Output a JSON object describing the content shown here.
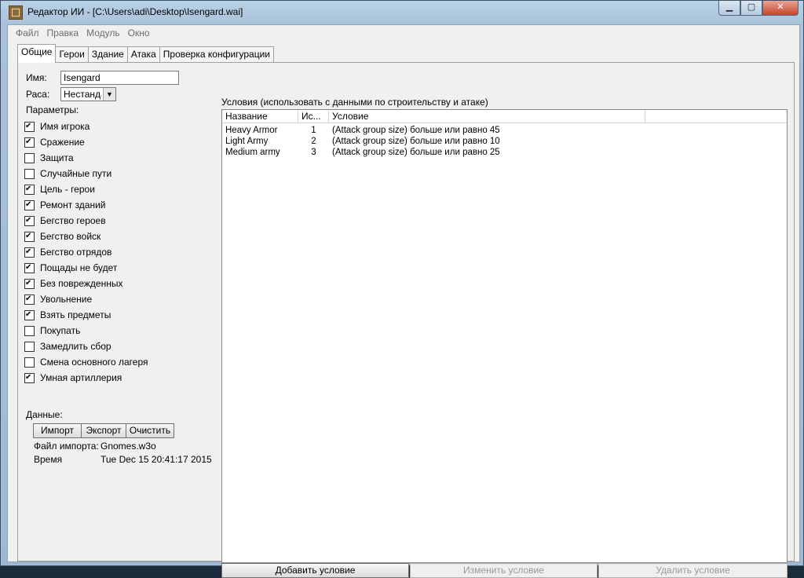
{
  "window": {
    "title": "Редактор ИИ - [C:\\Users\\adi\\Desktop\\Isengard.wai]",
    "minimize": "▁",
    "maximize": "▢",
    "close": "✕"
  },
  "menu": [
    "Файл",
    "Правка",
    "Модуль",
    "Окно"
  ],
  "tabs": [
    "Общие",
    "Герои",
    "Здание",
    "Атака",
    "Проверка конфигурации"
  ],
  "general": {
    "name_label": "Имя:",
    "name_value": "Isengard",
    "race_label": "Раса:",
    "race_value": "Нестандартная",
    "params_label": "Параметры:",
    "params": [
      {
        "label": "Имя игрока",
        "checked": true
      },
      {
        "label": "Сражение",
        "checked": true
      },
      {
        "label": "Защита",
        "checked": false
      },
      {
        "label": "Случайные пути",
        "checked": false
      },
      {
        "label": "Цель - герои",
        "checked": true
      },
      {
        "label": "Ремонт зданий",
        "checked": true
      },
      {
        "label": "Бегство героев",
        "checked": true
      },
      {
        "label": "Бегство войск",
        "checked": true
      },
      {
        "label": "Бегство отрядов",
        "checked": true
      },
      {
        "label": "Пощады не будет",
        "checked": true
      },
      {
        "label": "Без поврежденных",
        "checked": true
      },
      {
        "label": "Увольнение",
        "checked": true
      },
      {
        "label": "Взять предметы",
        "checked": true
      },
      {
        "label": "Покупать",
        "checked": false
      },
      {
        "label": "Замедлить сбор",
        "checked": false
      },
      {
        "label": "Смена основного лагеря",
        "checked": false
      },
      {
        "label": "Умная артиллерия",
        "checked": true
      }
    ],
    "data_label": "Данные:",
    "import_button": "Импорт",
    "export_button": "Экспорт",
    "clear_button": "Очистить",
    "import_file_label": "Файл импорта:",
    "import_file_value": "Gnomes.w3o",
    "time_label": "Время",
    "time_value": "Tue Dec 15 20:41:17 2015"
  },
  "conditions": {
    "group_label": "Условия (использовать с данными по строительству и атаке)",
    "columns": [
      "Название",
      "Ис...",
      "Условие",
      ""
    ],
    "rows": [
      {
        "name": "Heavy Armor",
        "index": "1",
        "condition": "(Attack group size) больше или равно 45"
      },
      {
        "name": "Light Army",
        "index": "2",
        "condition": "(Attack group size) больше или равно 10"
      },
      {
        "name": "Medium army",
        "index": "3",
        "condition": "(Attack group size) больше или равно 25"
      }
    ],
    "add_button": "Добавить условие",
    "edit_button": "Изменить условие",
    "delete_button": "Удалить условие"
  }
}
